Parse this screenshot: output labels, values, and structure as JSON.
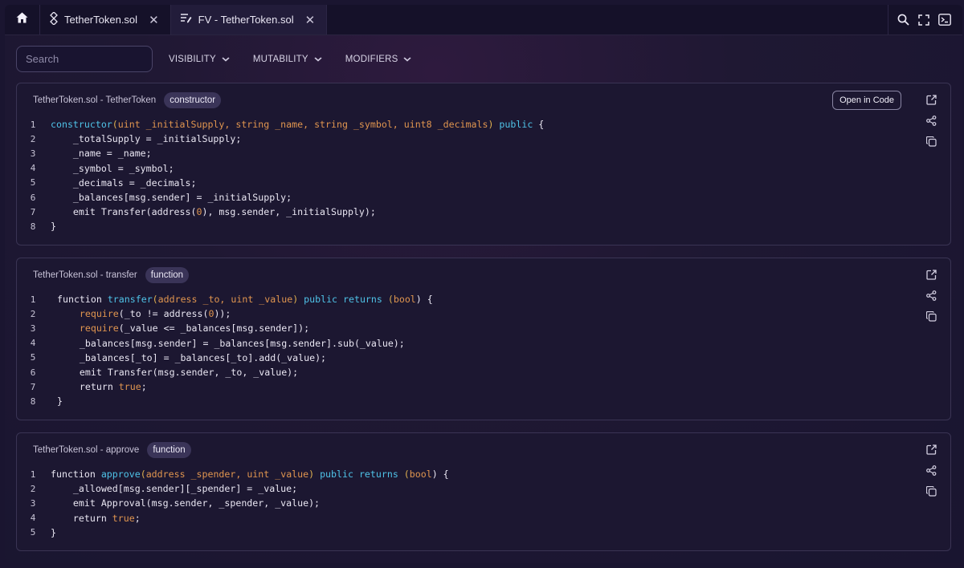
{
  "tabs": {
    "home_icon": "home-icon",
    "items": [
      {
        "label": "TetherToken.sol",
        "icon": "solidity-icon",
        "active": false
      },
      {
        "label": "FV - TetherToken.sol",
        "icon": "fv-icon",
        "active": true
      }
    ]
  },
  "toolbar": {
    "icons": [
      "search-icon",
      "fullscreen-icon",
      "terminal-icon"
    ]
  },
  "filters": {
    "search_placeholder": "Search",
    "visibility": "VISIBILITY",
    "mutability": "MUTABILITY",
    "modifiers": "MODIFIERS"
  },
  "cards": [
    {
      "title": "TetherToken.sol - TetherToken",
      "badge": "constructor",
      "open_label": "Open in Code",
      "line_numbers": [
        "1",
        "2",
        "3",
        "4",
        "5",
        "6",
        "7",
        "8"
      ]
    },
    {
      "title": "TetherToken.sol - transfer",
      "badge": "function",
      "line_numbers": [
        "1",
        "2",
        "3",
        "4",
        "5",
        "6",
        "7",
        "8"
      ]
    },
    {
      "title": "TetherToken.sol - approve",
      "badge": "function",
      "line_numbers": [
        "1",
        "2",
        "3",
        "4",
        "5"
      ]
    }
  ],
  "code": {
    "c1": {
      "l1_kw": "constructor",
      "l1_open": "(",
      "l1_params": "uint _initialSupply, string _name, string _symbol, uint8 _decimals",
      "l1_close": ")",
      "l1_vis": "public",
      "l1_end": " {",
      "l2": "    _totalSupply = _initialSupply;",
      "l3": "    _name = _name;",
      "l4": "    _symbol = _symbol;",
      "l5": "    _decimals = _decimals;",
      "l6": "    _balances[msg.sender] = _initialSupply;",
      "l7_a": "    emit Transfer(address(",
      "l7_num": "0",
      "l7_b": "), msg.sender, _initialSupply);",
      "l8": "}"
    },
    "c2": {
      "l1_fn": "function ",
      "l1_name": "transfer",
      "l1_open": "(",
      "l1_params": "address _to, uint _value",
      "l1_close": ") ",
      "l1_vis": "public returns",
      "l1_ret_open": " (",
      "l1_ret": "bool",
      "l1_end": ") {",
      "l2_req": "    require",
      "l2_a": "(_to != address(",
      "l2_num": "0",
      "l2_b": "));",
      "l3_req": "    require",
      "l3_a": "(_value <= _balances[msg.sender]);",
      "l4": "    _balances[msg.sender] = _balances[msg.sender].sub(_value);",
      "l5": "    _balances[_to] = _balances[_to].add(_value);",
      "l6": "    emit Transfer(msg.sender, _to, _value);",
      "l7_a": "    return ",
      "l7_bool": "true",
      "l7_b": ";",
      "l8": "}"
    },
    "c3": {
      "l1_fn": "function ",
      "l1_name": "approve",
      "l1_open": "(",
      "l1_params": "address _spender, uint _value",
      "l1_close": ") ",
      "l1_vis": "public returns",
      "l1_ret_open": " (",
      "l1_ret": "bool",
      "l1_end": ") {",
      "l2": "    _allowed[msg.sender][_spender] = _value;",
      "l3": "    emit Approval(msg.sender, _spender, _value);",
      "l4_a": "    return ",
      "l4_bool": "true",
      "l4_b": ";",
      "l5": "}"
    }
  }
}
